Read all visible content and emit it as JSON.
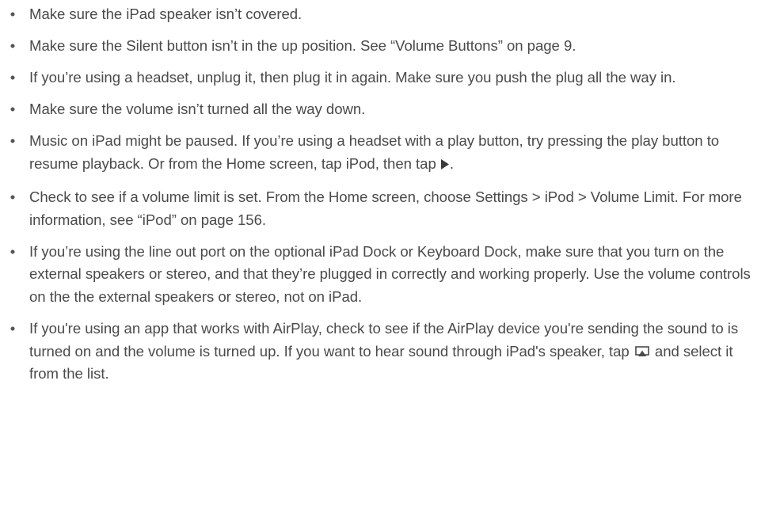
{
  "bullet_glyph": "•",
  "items": [
    {
      "text": "Make sure the iPad speaker isn’t covered."
    },
    {
      "text": "Make sure the Silent button isn’t in the up position. See “Volume Buttons” on page 9."
    },
    {
      "text": "If you’re using a headset, unplug it, then plug it in again. Make sure you push the plug all the way in."
    },
    {
      "text": "Make sure the volume isn’t turned all the way down."
    },
    {
      "text": "Music on iPad might be paused. If you’re using a headset with a play button, try pressing the play button to resume playback. Or from the Home screen, tap iPod, then tap ",
      "icon": "play-icon",
      "after": "."
    },
    {
      "text": "Check to see if a volume limit is set. From the Home screen, choose Settings > iPod > Volume Limit. For more information, see “iPod” on page 156."
    },
    {
      "text": "If you’re using the line out port on the optional iPad Dock or Keyboard Dock, make sure that you turn on the external speakers or stereo, and that they’re plugged in correctly and working properly. Use the volume controls on the the external speakers or stereo, not on iPad."
    },
    {
      "text": "If you're using an app that works with AirPlay, check to see if the AirPlay device you're sending the sound to is turned on and the volume is turned up. If you want to hear sound through iPad's speaker, tap ",
      "icon": "airplay-icon",
      "after": " and select it from the list."
    }
  ]
}
